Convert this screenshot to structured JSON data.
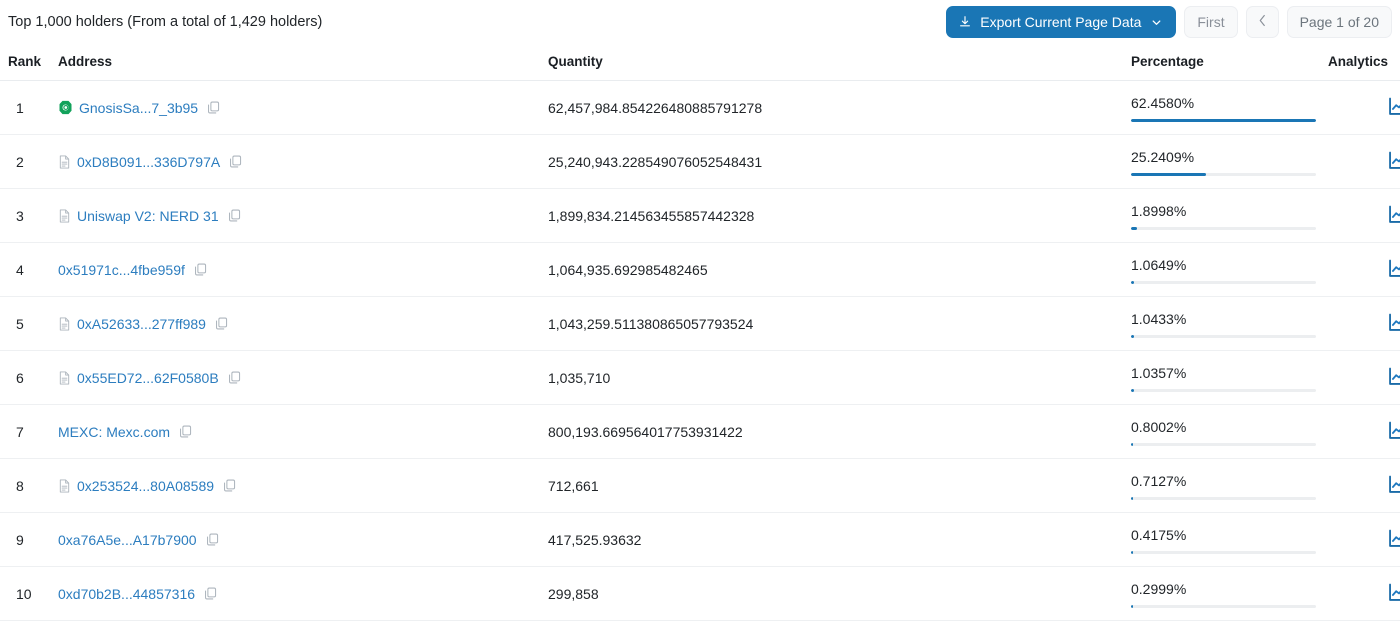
{
  "header": {
    "title": "Top 1,000 holders (From a total of 1,429 holders)",
    "export_label": "Export Current Page Data",
    "pagination": {
      "first_label": "First",
      "prev_label": "‹",
      "page_label": "Page 1 of 20"
    }
  },
  "table": {
    "columns": {
      "rank": "Rank",
      "address": "Address",
      "quantity": "Quantity",
      "percentage": "Percentage",
      "analytics": "Analytics"
    },
    "rows": [
      {
        "rank": "1",
        "address": "GnosisSa...7_3b95",
        "badge": "gnosis-safe-icon",
        "quantity": "62,457,984.854226480885791278",
        "percentage": "62.4580%",
        "bar_fill": 100.0
      },
      {
        "rank": "2",
        "address": "0xD8B091...336D797A",
        "badge": "contract-icon",
        "quantity": "25,240,943.228549076052548431",
        "percentage": "25.2409%",
        "bar_fill": 40.4
      },
      {
        "rank": "3",
        "address": "Uniswap V2: NERD 31",
        "badge": "contract-icon",
        "quantity": "1,899,834.214563455857442328",
        "percentage": "1.8998%",
        "bar_fill": 3.04
      },
      {
        "rank": "4",
        "address": "0x51971c...4fbe959f",
        "badge": "none",
        "quantity": "1,064,935.692985482465",
        "percentage": "1.0649%",
        "bar_fill": 1.7
      },
      {
        "rank": "5",
        "address": "0xA52633...277ff989",
        "badge": "contract-icon",
        "quantity": "1,043,259.511380865057793524",
        "percentage": "1.0433%",
        "bar_fill": 1.67
      },
      {
        "rank": "6",
        "address": "0x55ED72...62F0580B",
        "badge": "contract-icon",
        "quantity": "1,035,710",
        "percentage": "1.0357%",
        "bar_fill": 1.66
      },
      {
        "rank": "7",
        "address": "MEXC: Mexc.com",
        "badge": "none",
        "quantity": "800,193.669564017753931422",
        "percentage": "0.8002%",
        "bar_fill": 1.28
      },
      {
        "rank": "8",
        "address": "0x253524...80A08589",
        "badge": "contract-icon",
        "quantity": "712,661",
        "percentage": "0.7127%",
        "bar_fill": 1.14
      },
      {
        "rank": "9",
        "address": "0xa76A5e...A17b7900",
        "badge": "none",
        "quantity": "417,525.93632",
        "percentage": "0.4175%",
        "bar_fill": 0.67
      },
      {
        "rank": "10",
        "address": "0xd70b2B...44857316",
        "badge": "none",
        "quantity": "299,858",
        "percentage": "0.2999%",
        "bar_fill": 0.48
      }
    ]
  },
  "colors": {
    "accent": "#1a76b5",
    "link": "#2c7dbf",
    "safe_green": "#12a25b",
    "track": "#eceef0",
    "divider": "#eef0f2"
  }
}
